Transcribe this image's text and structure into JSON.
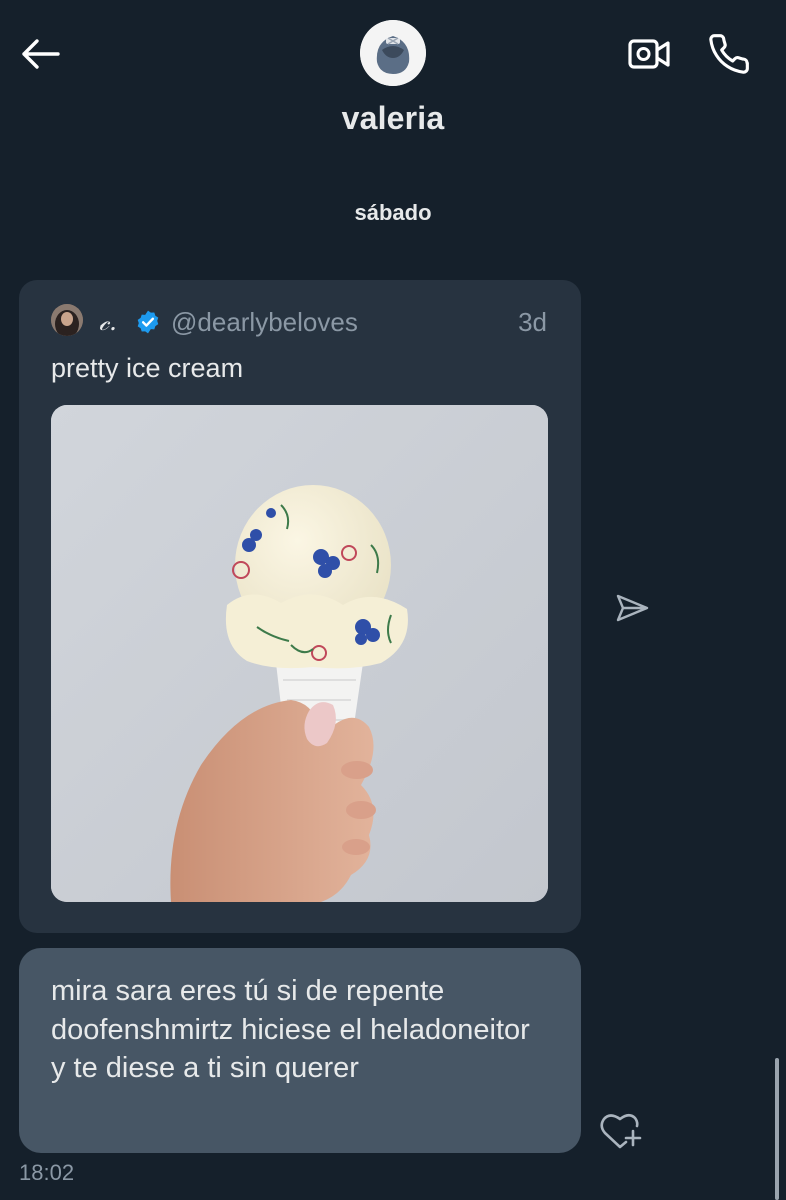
{
  "header": {
    "contact_name": "valeria",
    "icons": {
      "back": "arrow-left-icon",
      "video": "video-call-icon",
      "call": "phone-icon"
    }
  },
  "conversation": {
    "day_separator": "sábado",
    "shared_post": {
      "author_name": "𝒸.",
      "verified": true,
      "handle": "@dearlybeloves",
      "time_ago": "3d",
      "text": "pretty ice cream",
      "media": "photo-hand-holding-floral-ice-cream-cone"
    },
    "message": {
      "text": "mira sara eres tú si de repente doofenshmirtz hiciese el heladoneitor y te diese a ti sin querer",
      "time": "18:02"
    }
  },
  "colors": {
    "background": "#15202b",
    "card": "#273340",
    "bubble": "#475665",
    "muted_text": "#8b98a5",
    "verified_blue": "#1d9bf0"
  }
}
